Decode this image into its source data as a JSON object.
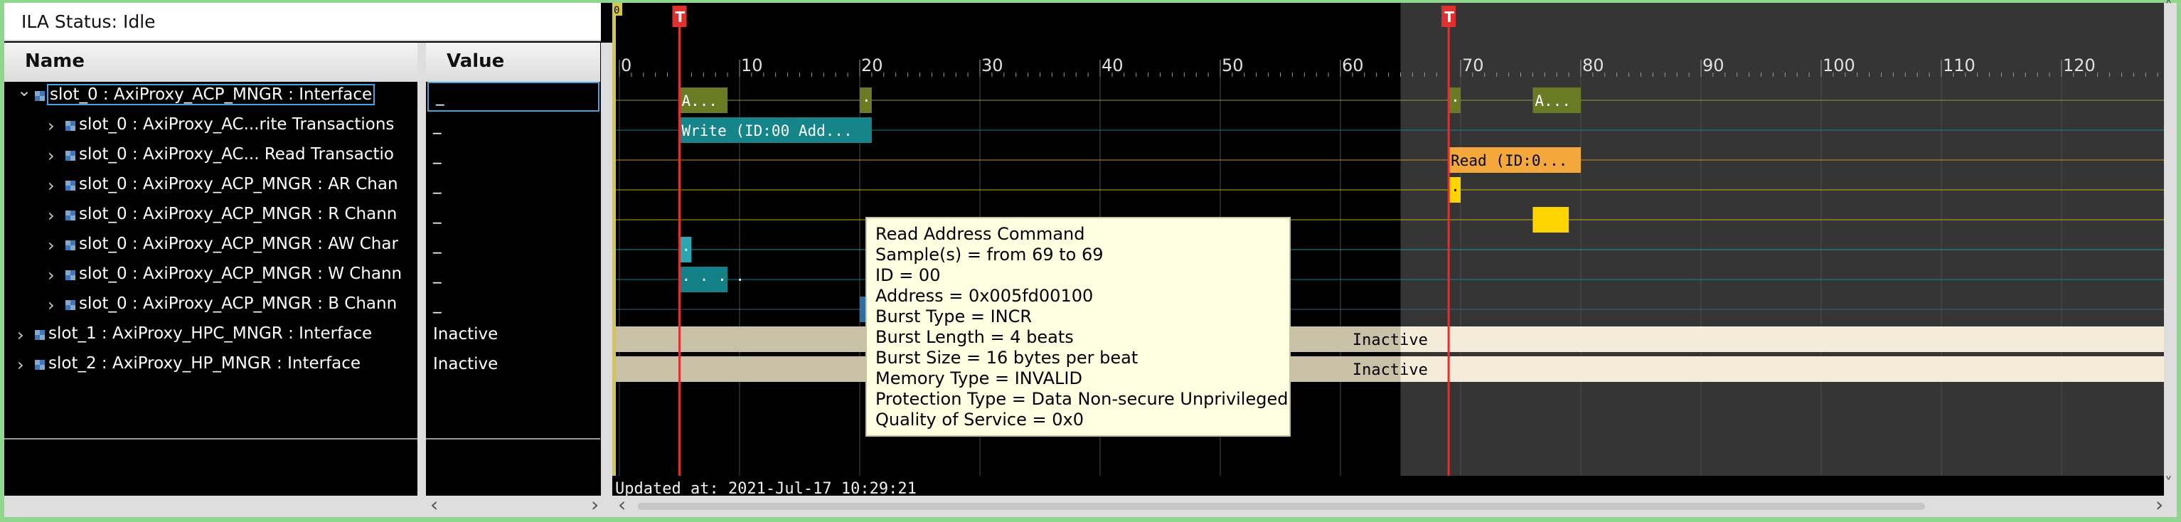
{
  "status": {
    "label": "ILA Status: Idle"
  },
  "columns": {
    "name": "Name",
    "value": "Value"
  },
  "tree": [
    {
      "label": "slot_0 : AxiProxy_ACP_MNGR : Interface",
      "value": "_",
      "expanded": true,
      "level": 0
    },
    {
      "label": "slot_0 : AxiProxy_AC...rite Transactions",
      "value": "_",
      "level": 1
    },
    {
      "label": "slot_0 : AxiProxy_AC... Read Transactio",
      "value": "_",
      "level": 1
    },
    {
      "label": "slot_0 : AxiProxy_ACP_MNGR : AR Chan",
      "value": "_",
      "level": 1
    },
    {
      "label": "slot_0 : AxiProxy_ACP_MNGR : R Chann",
      "value": "_",
      "level": 1
    },
    {
      "label": "slot_0 : AxiProxy_ACP_MNGR : AW Char",
      "value": "_",
      "level": 1
    },
    {
      "label": "slot_0 : AxiProxy_ACP_MNGR : W Chann",
      "value": "_",
      "level": 1
    },
    {
      "label": "slot_0 : AxiProxy_ACP_MNGR : B Chann",
      "value": "_",
      "level": 1
    },
    {
      "label": "slot_1 : AxiProxy_HPC_MNGR : Interface",
      "value": "Inactive",
      "level": 0
    },
    {
      "label": "slot_2 : AxiProxy_HP_MNGR : Interface",
      "value": "Inactive",
      "level": 0
    }
  ],
  "timeline": {
    "ticks": [
      0,
      10,
      20,
      30,
      40,
      50,
      60,
      70,
      80,
      90,
      100,
      110,
      120
    ],
    "corner_marker": "0",
    "trigger_markers": [
      {
        "label": "T",
        "sample": 5
      },
      {
        "label": "T",
        "sample": 69
      }
    ],
    "segments": [
      {
        "row": 0,
        "from": 5,
        "to": 9,
        "text": "A...",
        "color": "#6b7b25"
      },
      {
        "row": 0,
        "from": 20,
        "to": 21,
        "text": "·",
        "color": "#6b7b25"
      },
      {
        "row": 0,
        "from": 69,
        "to": 70,
        "text": "·",
        "color": "#6b7b25"
      },
      {
        "row": 0,
        "from": 76,
        "to": 80,
        "text": "A...",
        "color": "#6b7b25"
      },
      {
        "row": 1,
        "from": 5,
        "to": 21,
        "text": "Write (ID:00 Add...",
        "color": "#16858a"
      },
      {
        "row": 2,
        "from": 69,
        "to": 80,
        "text": "Read (ID:0...",
        "color": "#f4a73a"
      },
      {
        "row": 3,
        "from": 69,
        "to": 70,
        "text": "·",
        "color": "#ffd400"
      },
      {
        "row": 4,
        "from": 76,
        "to": 79,
        "text": "",
        "color": "#ffd400"
      },
      {
        "row": 5,
        "from": 5,
        "to": 6,
        "text": "·",
        "color": "#2aa7b3"
      },
      {
        "row": 6,
        "from": 5,
        "to": 9,
        "text": "· · · ·",
        "color": "#137f86"
      },
      {
        "row": 7,
        "from": 20,
        "to": 21,
        "text": "·",
        "color": "#2d6ea3"
      }
    ],
    "inactive_label": "Inactive",
    "updated_at": "Updated at: 2021-Jul-17 10:29:21"
  },
  "tooltip": {
    "lines": [
      "Read Address Command",
      "Sample(s) = from 69 to 69",
      "ID = 00",
      "Address = 0x005fd00100",
      "Burst Type = INCR",
      "Burst Length = 4 beats",
      "Burst Size = 16 bytes per beat",
      "Memory Type = INVALID",
      "Protection Type = Data Non-secure Unprivileged",
      "Quality of Service = 0x0"
    ]
  },
  "colors": {
    "accent_selection": "#4aa3df",
    "trigger": "#e03030",
    "inactive_bar": "#c9c0a8",
    "inactive_bar_right": "#f4ecd8",
    "tooltip_bg": "#ffffe1"
  },
  "icons": {
    "expand": "chevron-right-icon",
    "collapse": "chevron-down-icon",
    "signal": "interface-signal-icon"
  }
}
